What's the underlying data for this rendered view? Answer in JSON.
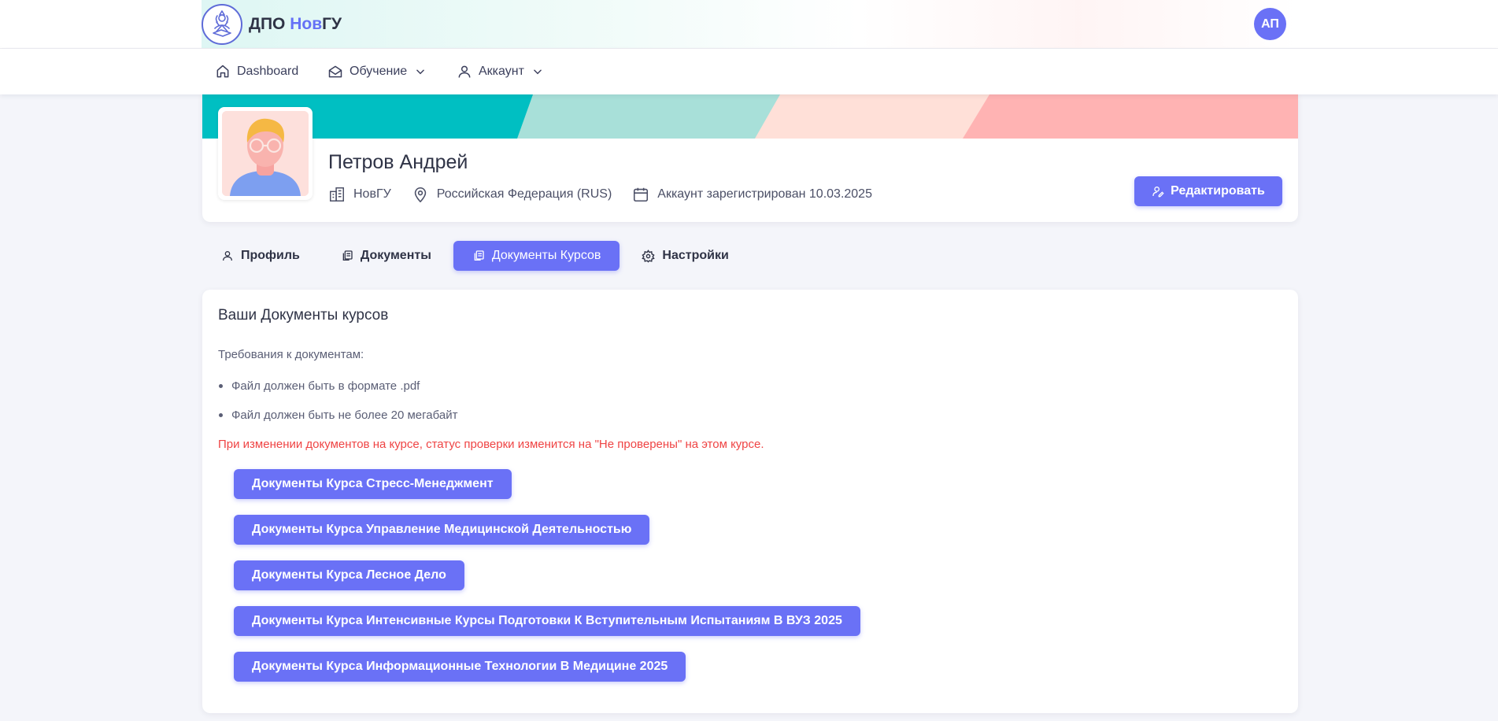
{
  "header": {
    "brand_prefix": "ДПО ",
    "brand_accent": "Нов",
    "brand_suffix": "ГУ",
    "user_initials": "АП"
  },
  "nav": {
    "items": [
      {
        "label": "Dashboard",
        "icon": "home-icon"
      },
      {
        "label": "Обучение",
        "icon": "open-mail-icon",
        "dropdown": true
      },
      {
        "label": "Аккаунт",
        "icon": "user-icon",
        "dropdown": true
      }
    ]
  },
  "profile": {
    "name": "Петров Андрей",
    "organization": "НовГУ",
    "country": "Российская Федерация (RUS)",
    "registered": "Аккаунт зарегистрирован 10.03.2025",
    "edit_label": "Редактировать"
  },
  "tabs": [
    {
      "label": "Профиль",
      "icon": "user-icon",
      "active": false
    },
    {
      "label": "Документы",
      "icon": "copy-icon",
      "active": false
    },
    {
      "label": "Документы Курсов",
      "icon": "copy-icon",
      "active": true
    },
    {
      "label": "Настройки",
      "icon": "gear-icon",
      "active": false
    }
  ],
  "course_docs": {
    "title": "Ваши Документы курсов",
    "requirements_label": "Требования к документам:",
    "requirements": [
      "Файл должен быть в формате .pdf",
      "Файл должен быть не более 20 мегабайт"
    ],
    "warning": "При изменении документов на курсе, статус проверки изменится на \"Не проверены\" на этом курсе.",
    "courses": [
      "Документы Курса Стресс-Менеджмент",
      "Документы Курса Управление Медицинской Деятельностью",
      "Документы Курса Лесное Дело",
      "Документы Курса Интенсивные Курсы Подготовки К Вступительным Испытаниям В ВУЗ 2025",
      "Документы Курса Информационные Технологии В Медицине 2025"
    ]
  },
  "colors": {
    "accent": "#6a71f6",
    "warning": "#ef4444",
    "cover_teal": "#00bfc2",
    "cover_mint": "#a8e0d9",
    "cover_peach": "#ffe0d8",
    "cover_rose": "#ffb3b3"
  }
}
